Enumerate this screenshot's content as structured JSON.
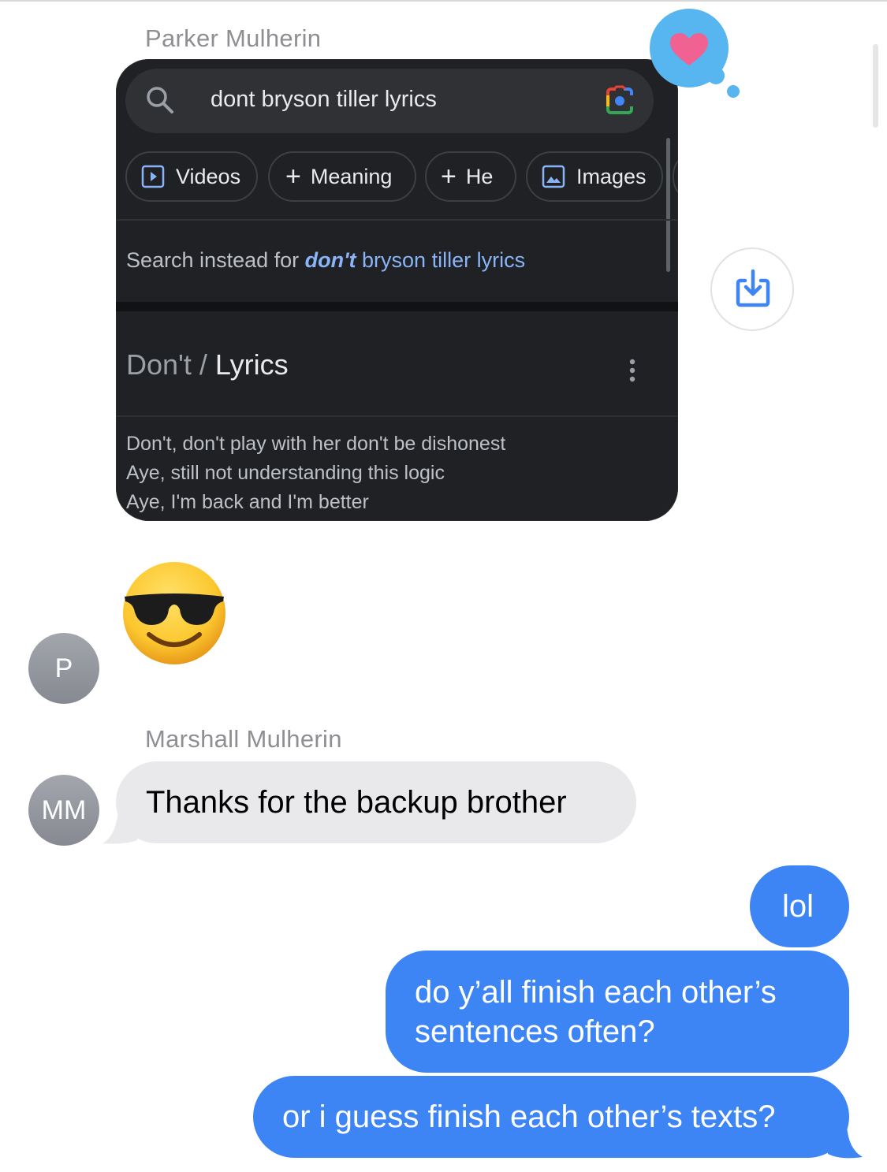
{
  "conversation": {
    "messages": [
      {
        "sender": "Parker Mulherin",
        "type": "screenshot",
        "reaction": "heart-icon",
        "screenshot": {
          "search": {
            "query": "dont bryson tiller lyrics"
          },
          "chips": [
            "Videos",
            "Meaning",
            "He",
            "Images"
          ],
          "suggestion": {
            "prefix": "Search instead for ",
            "bold": "don't",
            "rest": " bryson tiller lyrics"
          },
          "result": {
            "title_part1": "Don't / ",
            "title_part2": "Lyrics",
            "lines": [
              "Don't, don't play with her don't be dishonest",
              "Aye, still not understanding this logic",
              "Aye, I'm back and I'm better"
            ]
          }
        }
      },
      {
        "sender": "Parker Mulherin",
        "type": "emoji",
        "emoji": "smiling-face-with-sunglasses",
        "avatar_initials": "P"
      },
      {
        "sender": "Marshall Mulherin",
        "type": "text",
        "text": "Thanks for the backup brother",
        "avatar_initials": "MM"
      },
      {
        "sender": "me",
        "type": "text",
        "text": "lol"
      },
      {
        "sender": "me",
        "type": "text",
        "text": "do y’all finish each other’s sentences often?"
      },
      {
        "sender": "me",
        "type": "text",
        "text": "or i guess finish each other’s texts?"
      }
    ]
  },
  "labels": {
    "sender_parker": "Parker Mulherin",
    "sender_marshall": "Marshall Mulherin"
  },
  "colors": {
    "outgoing_bubble": "#3d85f5",
    "incoming_bubble": "#e9e9eb",
    "tapback": "#57b5f0",
    "heart": "#f06292",
    "card_bg": "#202124",
    "link": "#8ab4f8"
  }
}
